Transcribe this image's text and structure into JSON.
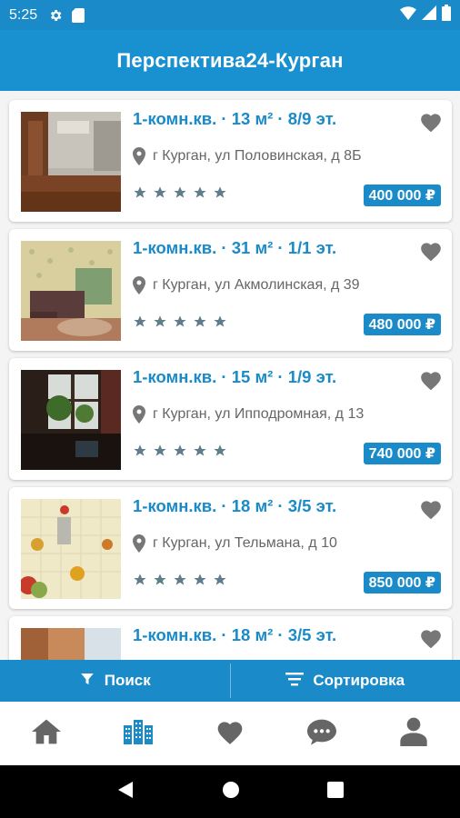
{
  "status_bar": {
    "time": "5:25"
  },
  "app_bar": {
    "title": "Перспектива24-Курган"
  },
  "listings": [
    {
      "title": "1-комн.кв. · 13 м² · 8/9 эт.",
      "address": "г Курган, ул Половинская, д 8Б",
      "price": "400 000 ₽"
    },
    {
      "title": "1-комн.кв. · 31 м² · 1/1 эт.",
      "address": "г Курган, ул Акмолинская, д 39",
      "price": "480 000 ₽"
    },
    {
      "title": "1-комн.кв. · 15 м² · 1/9 эт.",
      "address": "г Курган, ул Ипподромная, д 13",
      "price": "740 000 ₽"
    },
    {
      "title": "1-комн.кв. · 18 м² · 3/5 эт.",
      "address": "г Курган, ул Тельмана, д 10",
      "price": "850 000 ₽"
    },
    {
      "title": "1-комн.кв. · 18 м² · 3/5 эт.",
      "address": "",
      "price": ""
    }
  ],
  "actions": {
    "search_label": "Поиск",
    "sort_label": "Сортировка"
  },
  "tabs": [
    {
      "icon": "home-icon"
    },
    {
      "icon": "buildings-icon",
      "active": true
    },
    {
      "icon": "heart-icon"
    },
    {
      "icon": "chat-icon"
    },
    {
      "icon": "profile-icon"
    }
  ],
  "colors": {
    "primary": "#1a8bc8",
    "tab_active": "#1a8bc8",
    "tab_inactive": "#666666",
    "star": "#607d8b"
  }
}
